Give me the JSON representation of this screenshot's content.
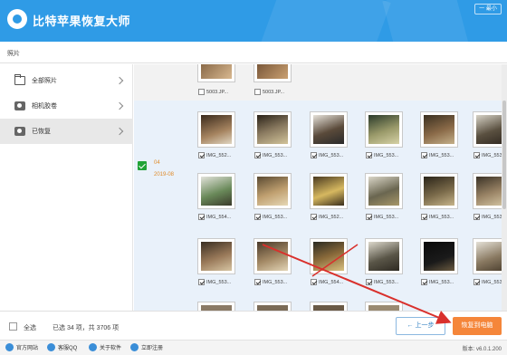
{
  "header": {
    "title": "比特苹果恢复大师",
    "window_buttons": [
      "一 最小",
      "✕"
    ]
  },
  "breadcrumb": {
    "label": "照片"
  },
  "sidebar": {
    "items": [
      {
        "label": "全部照片",
        "icon": "folder-icon"
      },
      {
        "label": "相机胶卷",
        "icon": "camera-icon"
      },
      {
        "label": "已恢复",
        "icon": "camera-icon",
        "active": true
      }
    ]
  },
  "group": {
    "day": "04",
    "year_month": "2019-08"
  },
  "top_row": [
    {
      "name": "5003.JP..."
    },
    {
      "name": "5003.JP..."
    }
  ],
  "rows": [
    [
      "IMG_552...",
      "IMG_553...",
      "IMG_553...",
      "IMG_553...",
      "IMG_553...",
      "IMG_553..."
    ],
    [
      "IMG_554...",
      "IMG_553...",
      "IMG_552...",
      "IMG_553...",
      "IMG_553...",
      "IMG_553..."
    ],
    [
      "IMG_553...",
      "IMG_553...",
      "IMG_554...",
      "IMG_553...",
      "IMG_553...",
      "IMG_553..."
    ]
  ],
  "footer": {
    "select_all": "全选",
    "selection_info": "已选 34 项，共 3706 项",
    "prev": "上一步",
    "next": "恢复到电脑"
  },
  "bottom_bar": {
    "items": [
      "官方网站",
      "客服QQ",
      "关于软件",
      "立即注册"
    ],
    "version": "版本: v6.0.1.200"
  },
  "colors": {
    "header": "#2f9be6",
    "accent": "#f5863a",
    "check": "#21a336",
    "group_bg": "#e9f1fa",
    "arrow": "#d9302c"
  }
}
